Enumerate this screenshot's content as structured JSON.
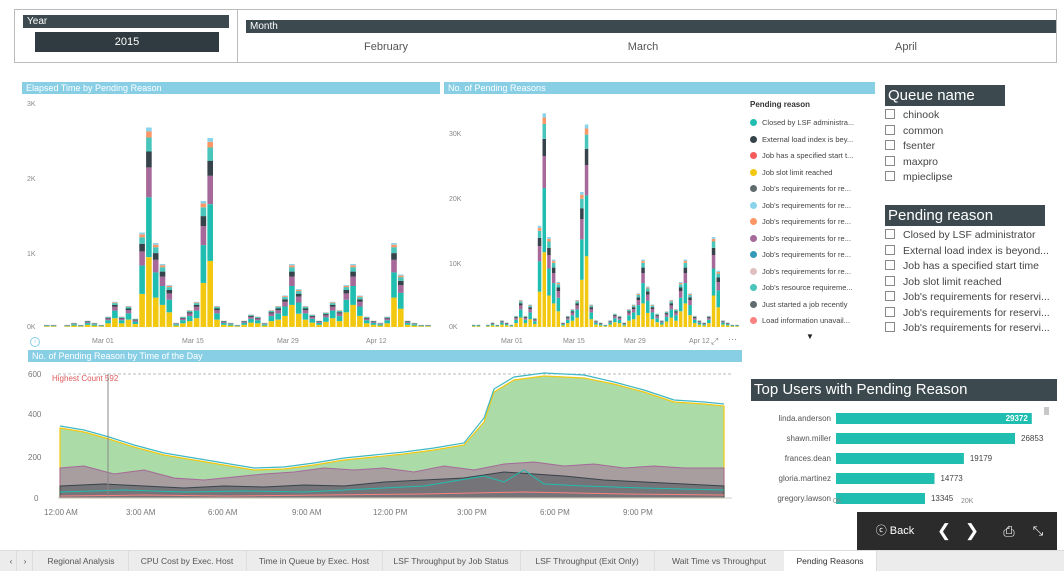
{
  "year_slicer": {
    "title": "Year",
    "selected": "2015"
  },
  "month_slicer": {
    "title": "Month",
    "months": [
      "February",
      "March",
      "April"
    ]
  },
  "elapsed_chart": {
    "title": "Elapsed Time by Pending Reason",
    "yticks": [
      "3K",
      "2K",
      "1K",
      "0K"
    ],
    "xticks": [
      "Mar 01",
      "Mar 15",
      "Mar 29",
      "Apr 12"
    ]
  },
  "pending_count_chart": {
    "title": "No. of Pending Reasons",
    "yticks": [
      "30K",
      "20K",
      "10K",
      "0K"
    ],
    "xticks": [
      "Mar 01",
      "Mar 15",
      "Mar 29",
      "Apr 12"
    ]
  },
  "legend": {
    "title": "Pending reason",
    "items": [
      {
        "label": "Closed by LSF administra...",
        "color": "#1fbeb0"
      },
      {
        "label": "External load index is bey...",
        "color": "#37434a"
      },
      {
        "label": "Job has a specified start t...",
        "color": "#f45b5b"
      },
      {
        "label": "Job slot limit reached",
        "color": "#f2c811"
      },
      {
        "label": "Job's requirements for re...",
        "color": "#5f6b6d"
      },
      {
        "label": "Job's requirements for re...",
        "color": "#8ad4eb"
      },
      {
        "label": "Job's requirements for re...",
        "color": "#fe9666"
      },
      {
        "label": "Job's requirements for re...",
        "color": "#a66999"
      },
      {
        "label": "Job's requirements for re...",
        "color": "#3599b8"
      },
      {
        "label": "Job's requirements for re...",
        "color": "#dfbfbf"
      },
      {
        "label": "Job's resource requireme...",
        "color": "#4ac5bb"
      },
      {
        "label": "Just started a job recently",
        "color": "#5f6b6d"
      },
      {
        "label": "Load information unavail...",
        "color": "#fb8281"
      }
    ]
  },
  "queue_panel": {
    "title": "Queue name",
    "items": [
      "chinook",
      "common",
      "fsenter",
      "maxpro",
      "mpieclipse"
    ]
  },
  "reason_panel": {
    "title": "Pending reason",
    "items": [
      "Closed by LSF administrator",
      "External load index is beyond...",
      "Job has a specified start time",
      "Job slot limit reached",
      "Job's requirements for reservi...",
      "Job's requirements for reservi...",
      "Job's requirements for reservi..."
    ]
  },
  "time_chart": {
    "title": "No. of Pending Reason by Time of the Day",
    "annotation": "Highest Count 592",
    "yticks": [
      "600",
      "400",
      "200",
      "0"
    ],
    "xticks": [
      "12:00 AM",
      "3:00 AM",
      "6:00 AM",
      "9:00 AM",
      "12:00 PM",
      "3:00 PM",
      "6:00 PM",
      "9:00 PM"
    ]
  },
  "top_users": {
    "title": "Top Users with Pending Reason",
    "xticks": [
      "0K",
      "20K"
    ]
  },
  "nav": {
    "back_label": "Back"
  },
  "tabs": [
    "Regional Analysis",
    "CPU Cost by Exec. Host",
    "Time in Queue by Exec. Host",
    "LSF Throughput by Job Status",
    "LSF Throughput (Exit Only)",
    "Wait Time vs Throughput",
    "Pending Reasons"
  ],
  "chart_data": [
    {
      "type": "bar",
      "title": "Top Users with Pending Reason",
      "categories": [
        "linda.anderson",
        "shawn.miller",
        "frances.dean",
        "gloria.martinez",
        "gregory.lawson"
      ],
      "values": [
        29372,
        26853,
        19179,
        14773,
        13345
      ],
      "xlim": [
        0,
        30000
      ],
      "color": "#1fbeb0"
    }
  ]
}
